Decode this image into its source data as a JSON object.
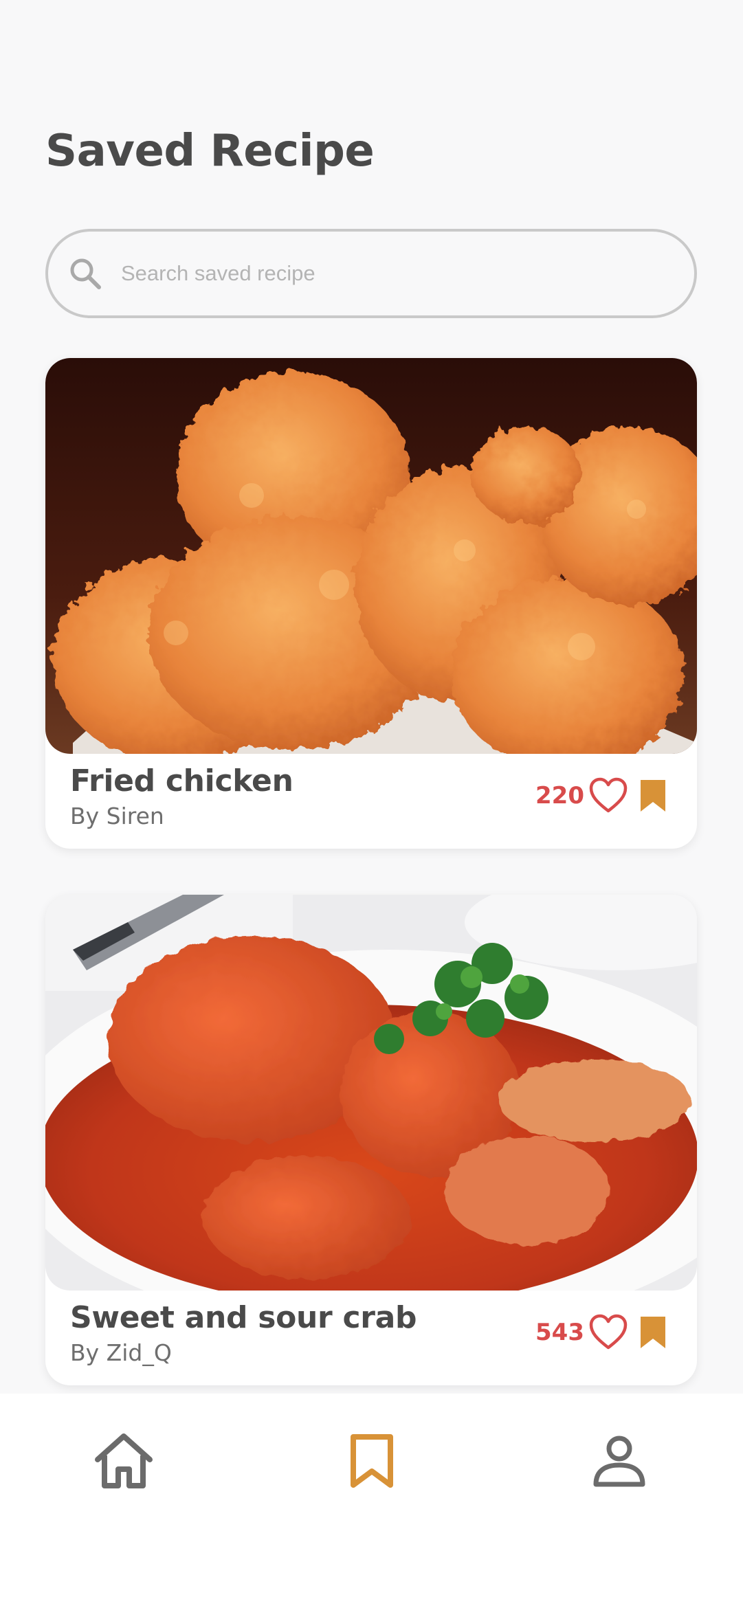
{
  "page": {
    "title": "Saved Recipe"
  },
  "search": {
    "placeholder": "Search saved recipe",
    "value": "",
    "icon": "search-icon"
  },
  "recipes": [
    {
      "title": "Fried chicken",
      "author": "By Siren",
      "likes": "220",
      "image": "fried-chicken-photo",
      "liked": false,
      "saved": true
    },
    {
      "title": "Sweet and sour crab",
      "author": "By Zid_Q",
      "likes": "543",
      "image": "sweet-and-sour-crab-photo",
      "liked": false,
      "saved": true
    }
  ],
  "bottom_nav": {
    "items": [
      {
        "name": "home",
        "icon": "home-icon",
        "active": false
      },
      {
        "name": "saved",
        "icon": "bookmark-icon",
        "active": true
      },
      {
        "name": "profile",
        "icon": "user-icon",
        "active": false
      }
    ]
  },
  "colors": {
    "accent": "#d89237",
    "like": "#d84b4b",
    "text_dark": "#4a4a4a",
    "text_muted": "#6e6e6e",
    "inactive_icon": "#6b6b6b",
    "background": "#f8f8f9"
  }
}
